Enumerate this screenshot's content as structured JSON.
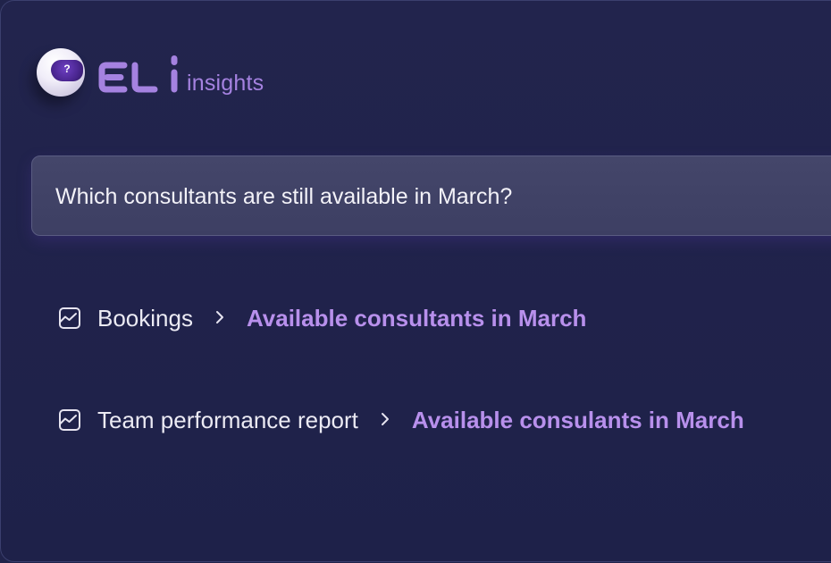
{
  "brand": {
    "logo_text": "ELi",
    "subtitle": "insights",
    "avatar_glyph": "?"
  },
  "query": {
    "text": "Which consultants are still available in March?"
  },
  "results": [
    {
      "icon": "line-chart-icon",
      "source": "Bookings",
      "separator_icon": "chevron-right-icon",
      "target": "Available consultants in March"
    },
    {
      "icon": "line-chart-icon",
      "source": "Team performance report",
      "separator_icon": "chevron-right-icon",
      "target": "Available consulants in March"
    }
  ],
  "colors": {
    "background": "#20234a",
    "accent": "#b890ec",
    "brand_purple": "#a582e0",
    "query_box": "#404266",
    "text": "#ebeaf3"
  }
}
